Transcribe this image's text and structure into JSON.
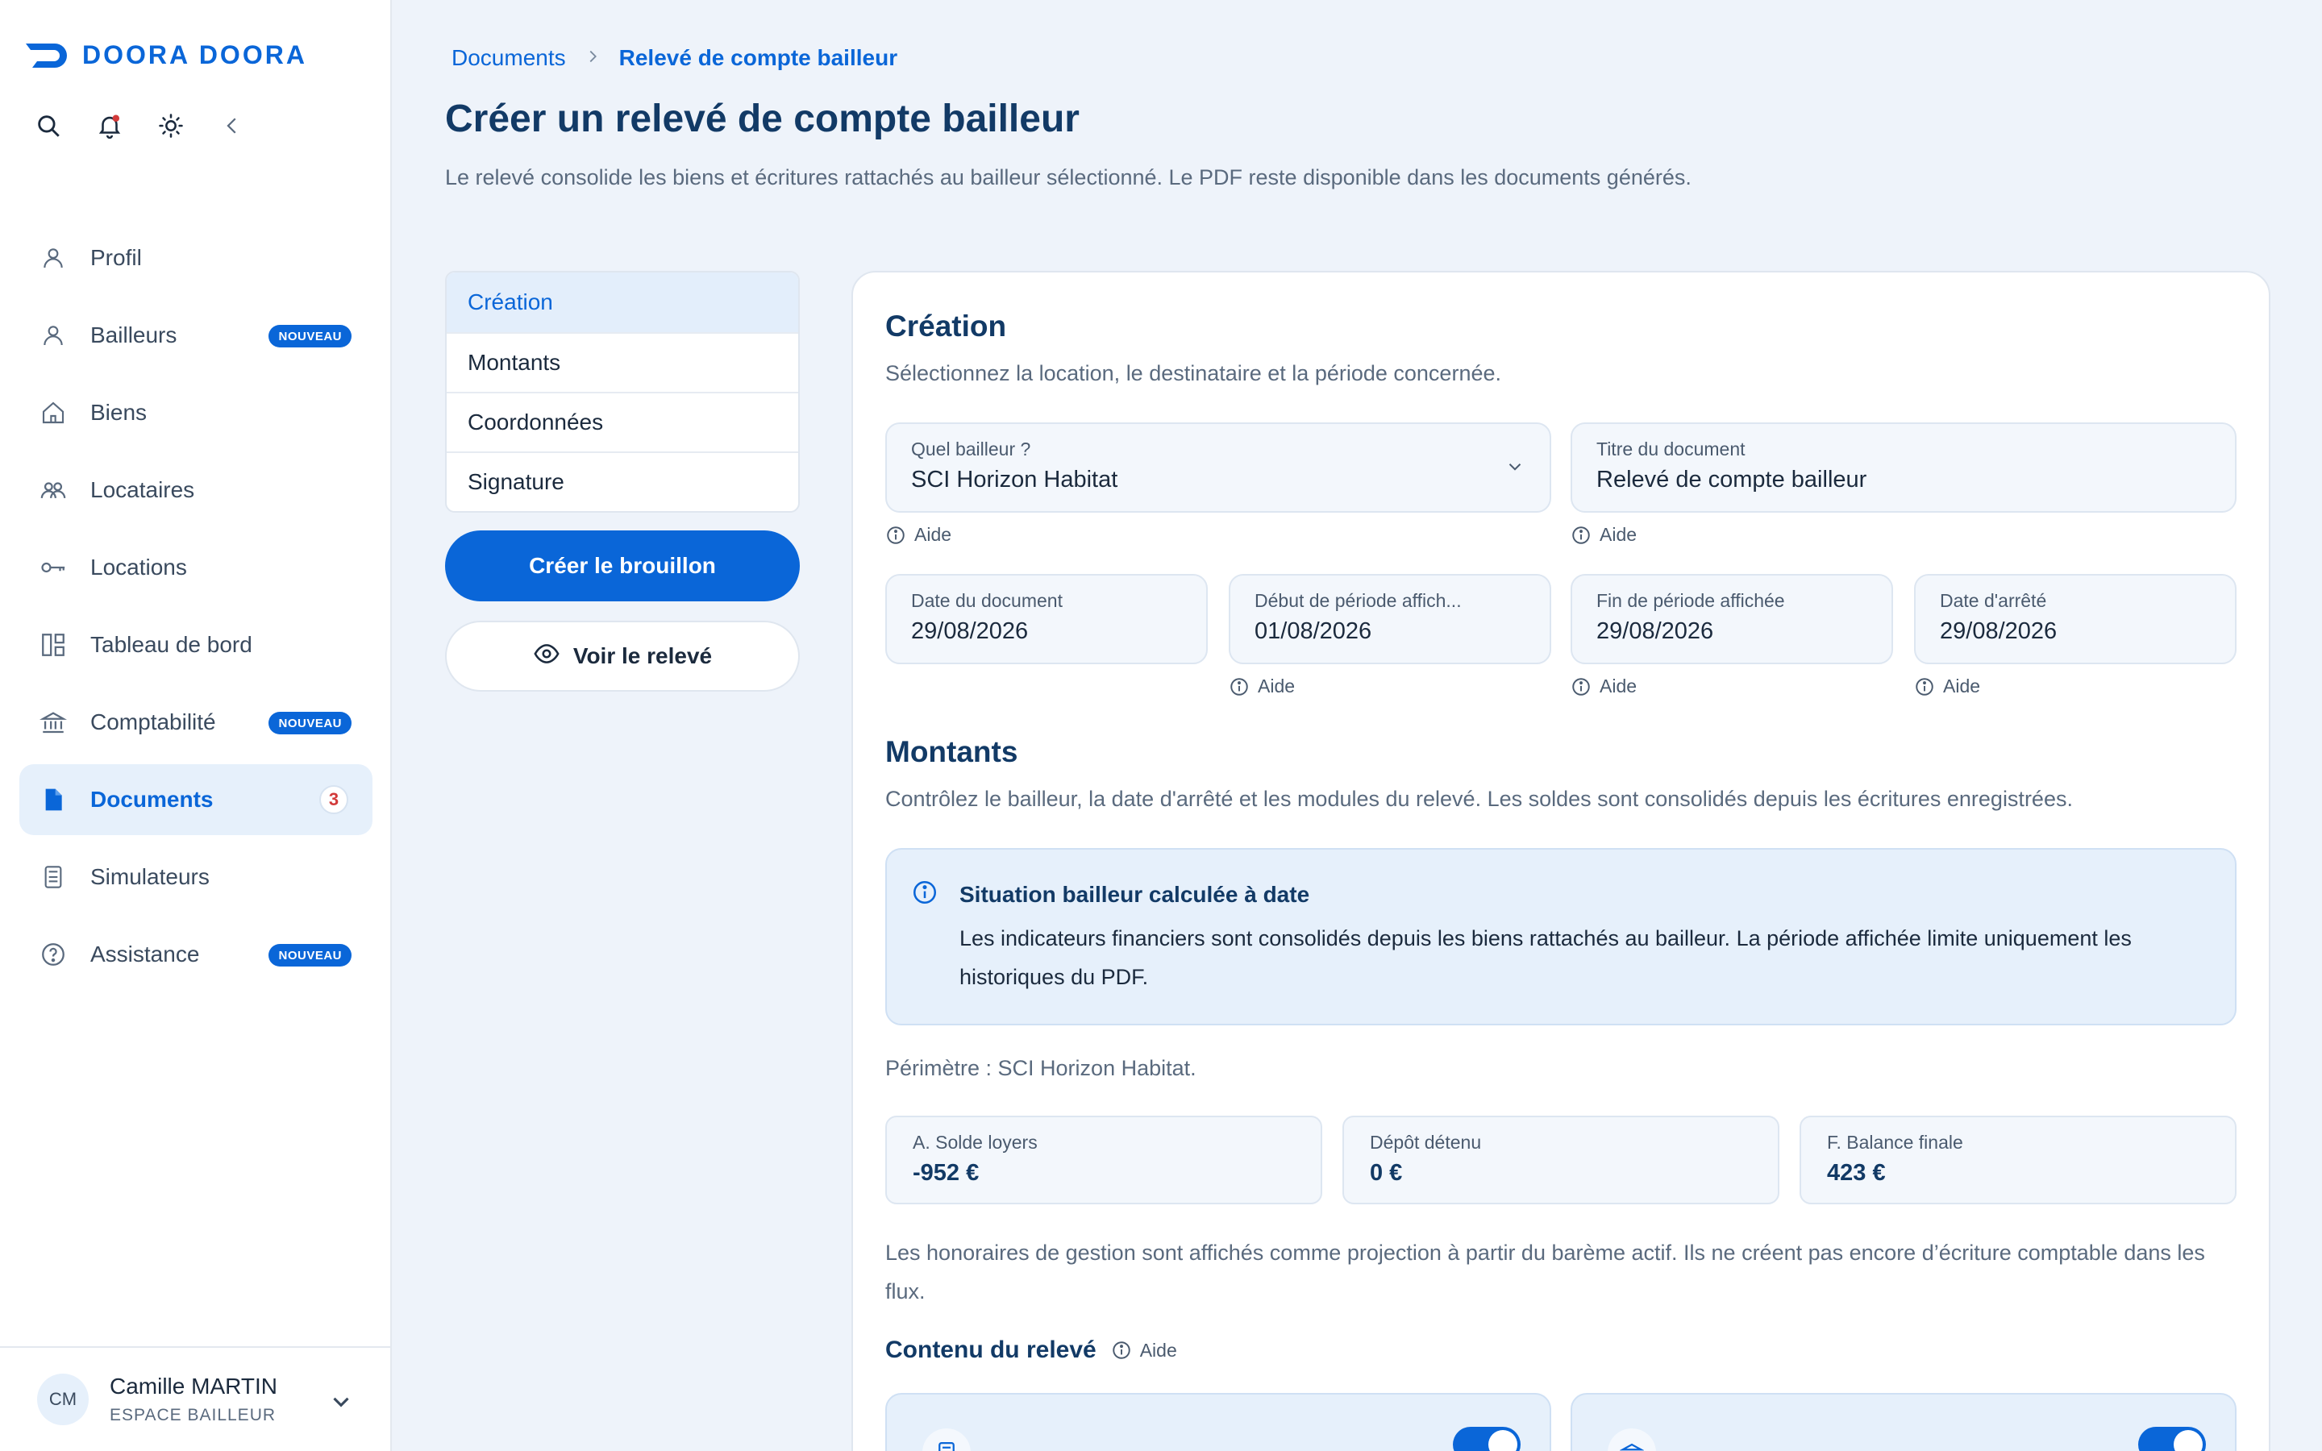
{
  "brand": {
    "name": "DOORA DOORA",
    "accent": "#0a66d8"
  },
  "sidebar": {
    "items": [
      {
        "label": "Profil",
        "icon": "user-icon"
      },
      {
        "label": "Bailleurs",
        "icon": "user-icon",
        "badge": "NOUVEAU"
      },
      {
        "label": "Biens",
        "icon": "home-icon"
      },
      {
        "label": "Locataires",
        "icon": "users-icon"
      },
      {
        "label": "Locations",
        "icon": "key-icon"
      },
      {
        "label": "Tableau de bord",
        "icon": "dashboard-icon"
      },
      {
        "label": "Comptabilité",
        "icon": "bank-icon",
        "badge": "NOUVEAU"
      },
      {
        "label": "Documents",
        "icon": "document-icon",
        "count": "3",
        "active": true
      },
      {
        "label": "Simulateurs",
        "icon": "calculator-icon"
      },
      {
        "label": "Assistance",
        "icon": "help-circle-icon",
        "badge": "NOUVEAU"
      }
    ]
  },
  "user": {
    "initials": "CM",
    "name": "Camille MARTIN",
    "role": "ESPACE BAILLEUR"
  },
  "breadcrumb": {
    "root": "Documents",
    "current": "Relevé de compte bailleur"
  },
  "page": {
    "title": "Créer un relevé de compte bailleur",
    "description": "Le relevé consolide les biens et écritures rattachés au bailleur sélectionné. Le PDF reste disponible dans les documents générés."
  },
  "steps": [
    "Création",
    "Montants",
    "Coordonnées",
    "Signature"
  ],
  "actions": {
    "create": "Créer le brouillon",
    "preview": "Voir le relevé"
  },
  "creation": {
    "title": "Création",
    "description": "Sélectionnez la location, le destinataire et la période concernée.",
    "help": "Aide",
    "bailleur": {
      "label": "Quel bailleur ?",
      "value": "SCI Horizon Habitat"
    },
    "doc_title": {
      "label": "Titre du document",
      "value": "Relevé de compte bailleur"
    },
    "date_doc": {
      "label": "Date du document",
      "value": "29/08/2026"
    },
    "start": {
      "label": "Début de période affich...",
      "value": "01/08/2026"
    },
    "end": {
      "label": "Fin de période affichée",
      "value": "29/08/2026"
    },
    "stop": {
      "label": "Date d'arrêté",
      "value": "29/08/2026"
    }
  },
  "montants": {
    "title": "Montants",
    "description": "Contrôlez le bailleur, la date d'arrêté et les modules du relevé. Les soldes sont consolidés depuis les écritures enregistrées.",
    "info_title": "Situation bailleur calculée à date",
    "info_text": "Les indicateurs financiers sont consolidés depuis les biens rattachés au bailleur. La période affichée limite uniquement les historiques du PDF.",
    "scope": "Périmètre : SCI Horizon Habitat.",
    "kpis": [
      {
        "label": "A. Solde loyers",
        "value": "-952 €"
      },
      {
        "label": "Dépôt détenu",
        "value": "0 €"
      },
      {
        "label": "F. Balance finale",
        "value": "423 €"
      }
    ],
    "fees": "Les honoraires de gestion sont affichés comme projection à partir du barème actif. Ils ne créent pas encore d’écriture comptable dans les flux."
  },
  "contenu": {
    "title": "Contenu du relevé",
    "help": "Aide"
  }
}
